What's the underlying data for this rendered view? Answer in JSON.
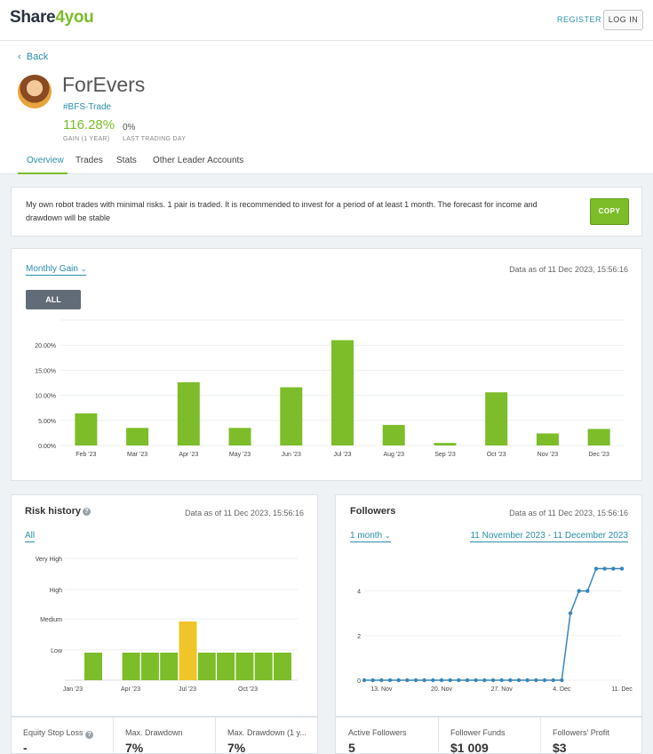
{
  "header": {
    "logo": {
      "part1": "Share",
      "part2": "4",
      "part3": "you"
    },
    "register_label": "REGISTER",
    "login_label": "LOG IN"
  },
  "profile": {
    "back_label": "Back",
    "name": "ForEvers",
    "tag": "#BFS-Trade",
    "gain_value": "116.28%",
    "gain_label": "GAIN (1 YEAR)",
    "last_day_value": "0%",
    "last_day_label": "LAST TRADING DAY",
    "tabs": [
      {
        "label": "Overview",
        "active": true
      },
      {
        "label": "Trades",
        "active": false
      },
      {
        "label": "Stats",
        "active": false
      },
      {
        "label": "Other Leader Accounts",
        "active": false
      }
    ]
  },
  "description": {
    "text": "My own robot trades with minimal risks. 1 pair is traded. It is recommended to invest for a period of at least 1 month. The forecast for income and drawdown will be stable",
    "copy_label": "COPY"
  },
  "monthly_gain": {
    "selector_label": "Monthly Gain",
    "as_of": "Data as of 11 Dec 2023, 15:56:16",
    "all_label": "ALL"
  },
  "risk_history": {
    "title": "Risk history",
    "as_of": "Data as of 11 Dec 2023, 15:56:16",
    "filter_label": "All"
  },
  "followers": {
    "title": "Followers",
    "as_of": "Data as of 11 Dec 2023, 15:56:16",
    "period_label": "1 month",
    "range_label": "11 November 2023 - 11 December 2023"
  },
  "stats_left": [
    {
      "label": "Equity Stop Loss",
      "value": "-",
      "help": true
    },
    {
      "label": "Max. Drawdown",
      "value": "7%"
    },
    {
      "label": "Max. Drawdown (1 y...",
      "value": "7%"
    }
  ],
  "stats_right": [
    {
      "label": "Active Followers",
      "value": "5"
    },
    {
      "label": "Follower Funds",
      "value": "$1 009"
    },
    {
      "label": "Followers' Profit",
      "value": "$3"
    }
  ],
  "colors": {
    "accent": "#2a8fa8",
    "green": "#7cbd29",
    "yellow": "#f0c52a",
    "line": "#3a86b8"
  },
  "chart_data": [
    {
      "type": "bar",
      "categories": [
        "Feb '23",
        "Mar '23",
        "Apr '23",
        "May '23",
        "Jun '23",
        "Jul '23",
        "Aug '23",
        "Sep '23",
        "Oct '23",
        "Nov '23",
        "Dec '23"
      ],
      "values": [
        6.4,
        3.5,
        12.6,
        3.5,
        11.6,
        21.0,
        4.1,
        0.5,
        10.6,
        2.4,
        3.3
      ],
      "yticks": [
        "0.00%",
        "5.00%",
        "10.00%",
        "15.00%",
        "20.00%"
      ],
      "ylim": [
        0,
        25
      ],
      "grid": true
    },
    {
      "type": "bar",
      "y_levels": [
        "Low",
        "Medium",
        "High",
        "Very High"
      ],
      "x_ticks": [
        "Jan '23",
        "Apr '23",
        "Jul '23",
        "Oct '23"
      ],
      "values": [
        1,
        0,
        1,
        1,
        1,
        2,
        1,
        1,
        1,
        1,
        1
      ],
      "highlight_value": 2,
      "grid": true
    },
    {
      "type": "line",
      "x_ticks": [
        "13. Nov",
        "20. Nov",
        "27. Nov",
        "4. Dec",
        "11. Dec"
      ],
      "yticks": [
        "0",
        "2",
        "4"
      ],
      "ylim": [
        0,
        5.5
      ],
      "values": [
        0,
        0,
        0,
        0,
        0,
        0,
        0,
        0,
        0,
        0,
        0,
        0,
        0,
        0,
        0,
        0,
        0,
        0,
        0,
        0,
        0,
        0,
        0,
        0,
        3,
        4,
        4,
        5,
        5,
        5,
        5
      ],
      "grid": true
    }
  ]
}
